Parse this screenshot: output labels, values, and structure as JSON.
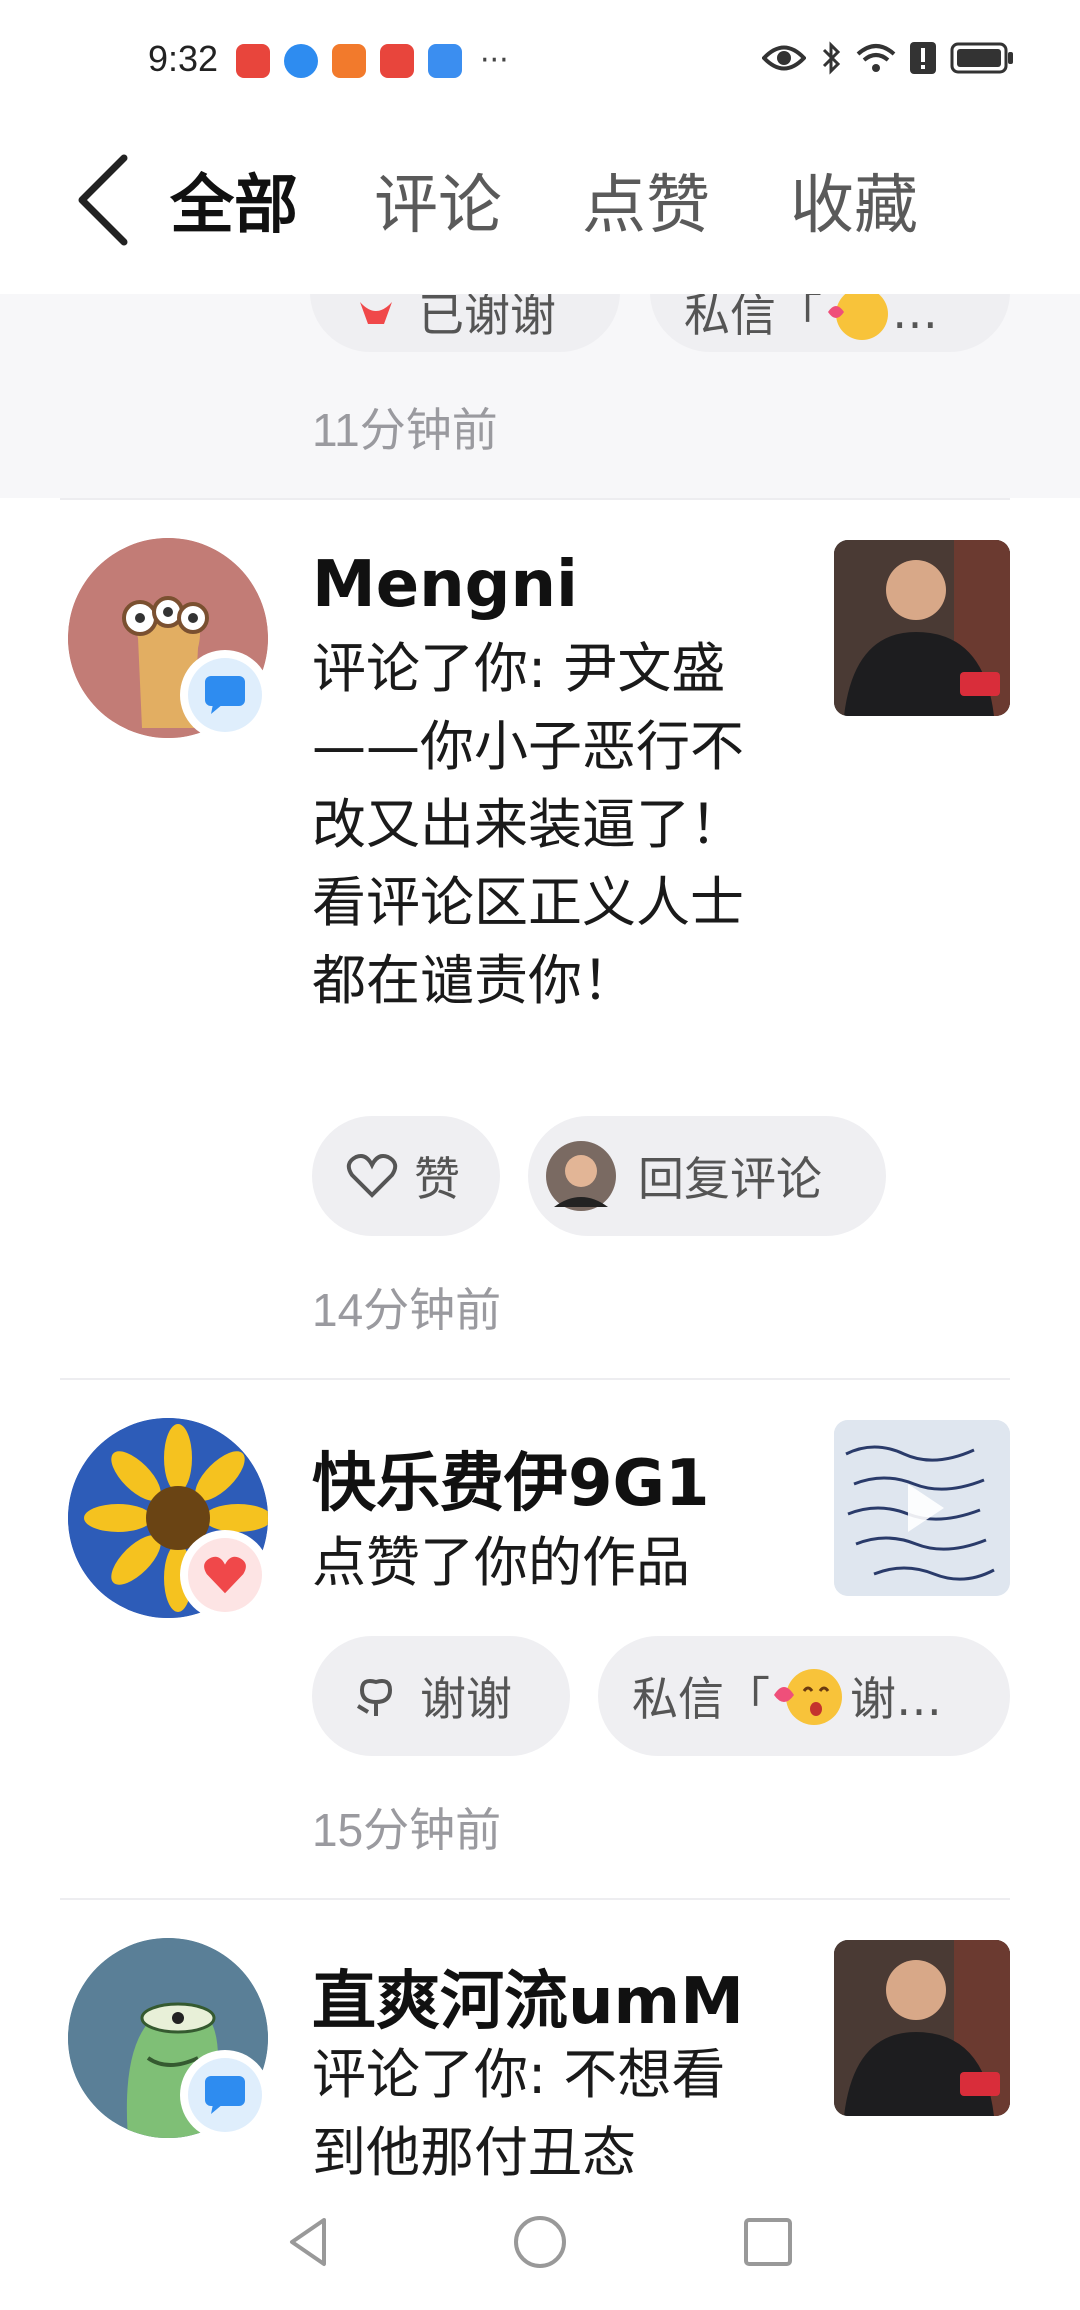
{
  "status_bar": {
    "time": "9:32",
    "more_icons": "···"
  },
  "tabs": [
    {
      "label": "全部",
      "active": true
    },
    {
      "label": "评论",
      "active": false
    },
    {
      "label": "点赞",
      "active": false
    },
    {
      "label": "收藏",
      "active": false
    }
  ],
  "top_partial": {
    "thanked_label": "已谢谢",
    "private_msg_label": "私信「",
    "ellipsis": "…",
    "time": "11分钟前"
  },
  "notifications": [
    {
      "username": "Mengni",
      "type": "comment",
      "message": "评论了你: 尹文盛——你小子恶行不改又出来装逼了！看评论区正义人士都在谴责你！",
      "actions": {
        "like": "赞",
        "reply": "回复评论"
      },
      "time": "14分钟前"
    },
    {
      "username": "快乐费伊9G1",
      "type": "like",
      "message": "点赞了你的作品",
      "actions": {
        "thanks": "谢谢",
        "private_msg": "私信「",
        "ellipsis": "谢…"
      },
      "time": "15分钟前"
    },
    {
      "username": "直爽河流umM",
      "type": "comment",
      "message": "评论了你: 不想看到他那付丑态"
    }
  ],
  "colors": {
    "accent_blue": "#2e8cf0",
    "like_red": "#f0484a",
    "muted_text": "#9a9a9f"
  }
}
